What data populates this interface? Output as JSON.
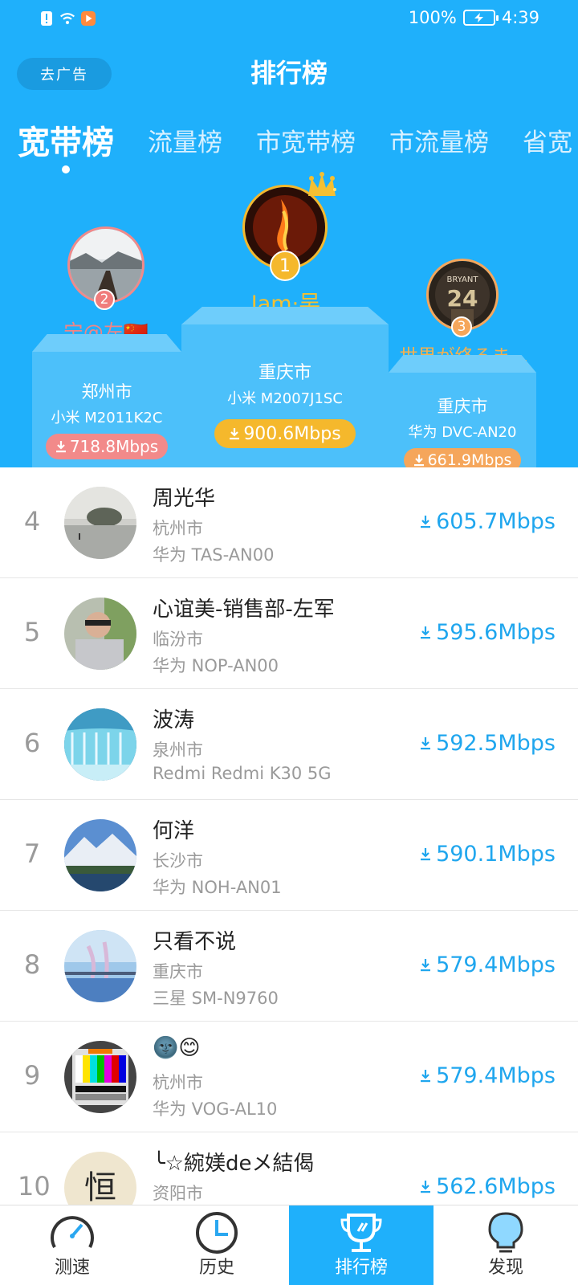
{
  "status": {
    "battery_pct": "100%",
    "time": "4:39"
  },
  "header": {
    "ad_button": "去广告",
    "title": "排行榜"
  },
  "tabs": [
    "宽带榜",
    "流量榜",
    "市宽带榜",
    "市流量榜",
    "省宽"
  ],
  "active_tab": 0,
  "podium": {
    "first": {
      "rank": "1",
      "name": "Jam·吴",
      "city": "重庆市",
      "model": "小米 M2007J1SC",
      "speed": "900.6Mbps"
    },
    "second": {
      "rank": "2",
      "name": "宁@左🇨🇳",
      "city": "郑州市",
      "model": "小米 M2011K2C",
      "speed": "718.8Mbps"
    },
    "third": {
      "rank": "3",
      "name": "世界が终るま…",
      "city": "重庆市",
      "model": "华为 DVC-AN20",
      "speed": "661.9Mbps"
    }
  },
  "list": [
    {
      "rank": "4",
      "name": "周光华",
      "city": "杭州市",
      "model": "华为 TAS-AN00",
      "speed": "605.7Mbps"
    },
    {
      "rank": "5",
      "name": "心谊美-销售部-左军",
      "city": "临汾市",
      "model": "华为 NOP-AN00",
      "speed": "595.6Mbps"
    },
    {
      "rank": "6",
      "name": "波涛",
      "city": "泉州市",
      "model": "Redmi Redmi K30 5G",
      "speed": "592.5Mbps"
    },
    {
      "rank": "7",
      "name": "何洋",
      "city": "长沙市",
      "model": "华为 NOH-AN01",
      "speed": "590.1Mbps"
    },
    {
      "rank": "8",
      "name": "只看不说",
      "city": "重庆市",
      "model": "三星 SM-N9760",
      "speed": "579.4Mbps"
    },
    {
      "rank": "9",
      "name": "🌚😊",
      "city": "杭州市",
      "model": "华为 VOG-AL10",
      "speed": "579.4Mbps"
    },
    {
      "rank": "10",
      "name": "╰☆綩媄deメ結偈",
      "city": "资阳市",
      "model": "",
      "speed": "562.6Mbps"
    }
  ],
  "nav": [
    {
      "label": "测速",
      "icon": "speedometer-icon"
    },
    {
      "label": "历史",
      "icon": "clock-icon"
    },
    {
      "label": "排行榜",
      "icon": "trophy-icon"
    },
    {
      "label": "发现",
      "icon": "lightbulb-icon"
    }
  ],
  "colors": {
    "primary": "#1fb0fb",
    "gold": "#f5b82c",
    "silver_pink": "#f07c7c",
    "bronze": "#f5a65b",
    "speed_blue": "#1fa6ee"
  }
}
